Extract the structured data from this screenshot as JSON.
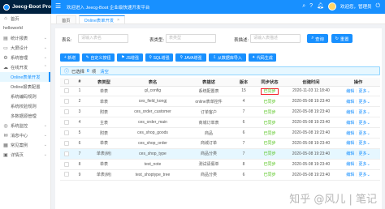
{
  "header": {
    "app_name": "Jeecg-Boot Pro",
    "welcome": "欢迎进入 Jeecg-Boot 企业级快速开发平台",
    "user_name": "管理员",
    "user_greeting": "欢迎您，管理员"
  },
  "tabs": [
    {
      "label": "首页"
    },
    {
      "label": "Online表单开发"
    }
  ],
  "sidebar": {
    "items": [
      {
        "label": "首页",
        "icon": "home-icon"
      },
      {
        "label": "helloworld",
        "icon": ""
      },
      {
        "label": "统计报表",
        "icon": "chart-icon"
      },
      {
        "label": "大屏设计",
        "icon": "screen-icon"
      },
      {
        "label": "系统管理",
        "icon": "setting-icon"
      },
      {
        "label": "在线开发",
        "icon": "cloud-icon"
      },
      {
        "label": "Online表单开发",
        "icon": ""
      },
      {
        "label": "Online报表配置",
        "icon": ""
      },
      {
        "label": "系统编码规则",
        "icon": ""
      },
      {
        "label": "系统校验规则",
        "icon": ""
      },
      {
        "label": "多数据源管理",
        "icon": ""
      },
      {
        "label": "系统监控",
        "icon": "monitor-icon"
      },
      {
        "label": "消息中心",
        "icon": "message-icon"
      },
      {
        "label": "常见案例",
        "icon": "case-icon"
      },
      {
        "label": "详情页",
        "icon": "detail-icon"
      }
    ]
  },
  "search": {
    "table_name_label": "表名:",
    "table_name_placeholder": "请输入表名",
    "table_type_label": "表类型:",
    "table_type_placeholder": "表类型",
    "table_desc_label": "表描述:",
    "table_desc_placeholder": "请输入表描述",
    "query_button": "查询",
    "reset_button": "重置"
  },
  "toolbar": {
    "new": "新增",
    "custom_button": "自定义按钮",
    "js_enhance": "JS增强",
    "sql_enhance": "SQL增强",
    "java_enhance": "JAVA增强",
    "import_from_db": "从数据库导入",
    "code_gen": "代码生成"
  },
  "selection": {
    "prefix": "已选择",
    "count": "0",
    "suffix": "项",
    "clear": "清空"
  },
  "table": {
    "columns": [
      "#",
      "表类型",
      "表名",
      "表描述",
      "版本",
      "同步状态",
      "创建时间",
      "操作"
    ],
    "rows": [
      {
        "index": "1",
        "type": "单表",
        "name": "gl_config",
        "desc": "系统配置表",
        "version": "15",
        "status": "已同步",
        "created": "2020-11-03 11:18:40"
      },
      {
        "index": "2",
        "type": "单表",
        "name": "ces_field_kongj",
        "desc": "online表单控件",
        "version": "4",
        "status": "已同步",
        "created": "2020-05-08 19:23:40"
      },
      {
        "index": "3",
        "type": "附表",
        "name": "ces_order_customer",
        "desc": "订单客户",
        "version": "7",
        "status": "已同步",
        "created": "2020-05-08 19:23:40"
      },
      {
        "index": "4",
        "type": "主表",
        "name": "ces_order_main",
        "desc": "商城订单表",
        "version": "6",
        "status": "已同步",
        "created": "2020-05-08 19:23:40"
      },
      {
        "index": "5",
        "type": "附表",
        "name": "ces_shop_goods",
        "desc": "商品",
        "version": "6",
        "status": "已同步",
        "created": "2020-05-08 19:23:40"
      },
      {
        "index": "6",
        "type": "单表",
        "name": "ces_shop_order",
        "desc": "商城订单",
        "version": "7",
        "status": "已同步",
        "created": "2020-05-08 19:23:40"
      },
      {
        "index": "7",
        "type": "单表(树)",
        "name": "ces_shop_type",
        "desc": "商品分类",
        "version": "7",
        "status": "已同步",
        "created": "2020-05-08 19:23:40"
      },
      {
        "index": "8",
        "type": "单表",
        "name": "test_note",
        "desc": "测试请假单",
        "version": "8",
        "status": "已同步",
        "created": "2020-05-08 19:23:40"
      },
      {
        "index": "9",
        "type": "单表(树)",
        "name": "test_shoptype_tree",
        "desc": "商品分类",
        "version": "6",
        "status": "已同步",
        "created": "2020-05-08 19:23:40"
      }
    ],
    "edit_label": "编辑",
    "more_label": "更多"
  },
  "watermark": "知乎 @风儿 | 笔记",
  "colors": {
    "primary": "#1890ff",
    "header_bg": "#1890ff",
    "logo_bg": "#002140",
    "success": "#52c41a",
    "highlight_box": "#f5222d"
  }
}
